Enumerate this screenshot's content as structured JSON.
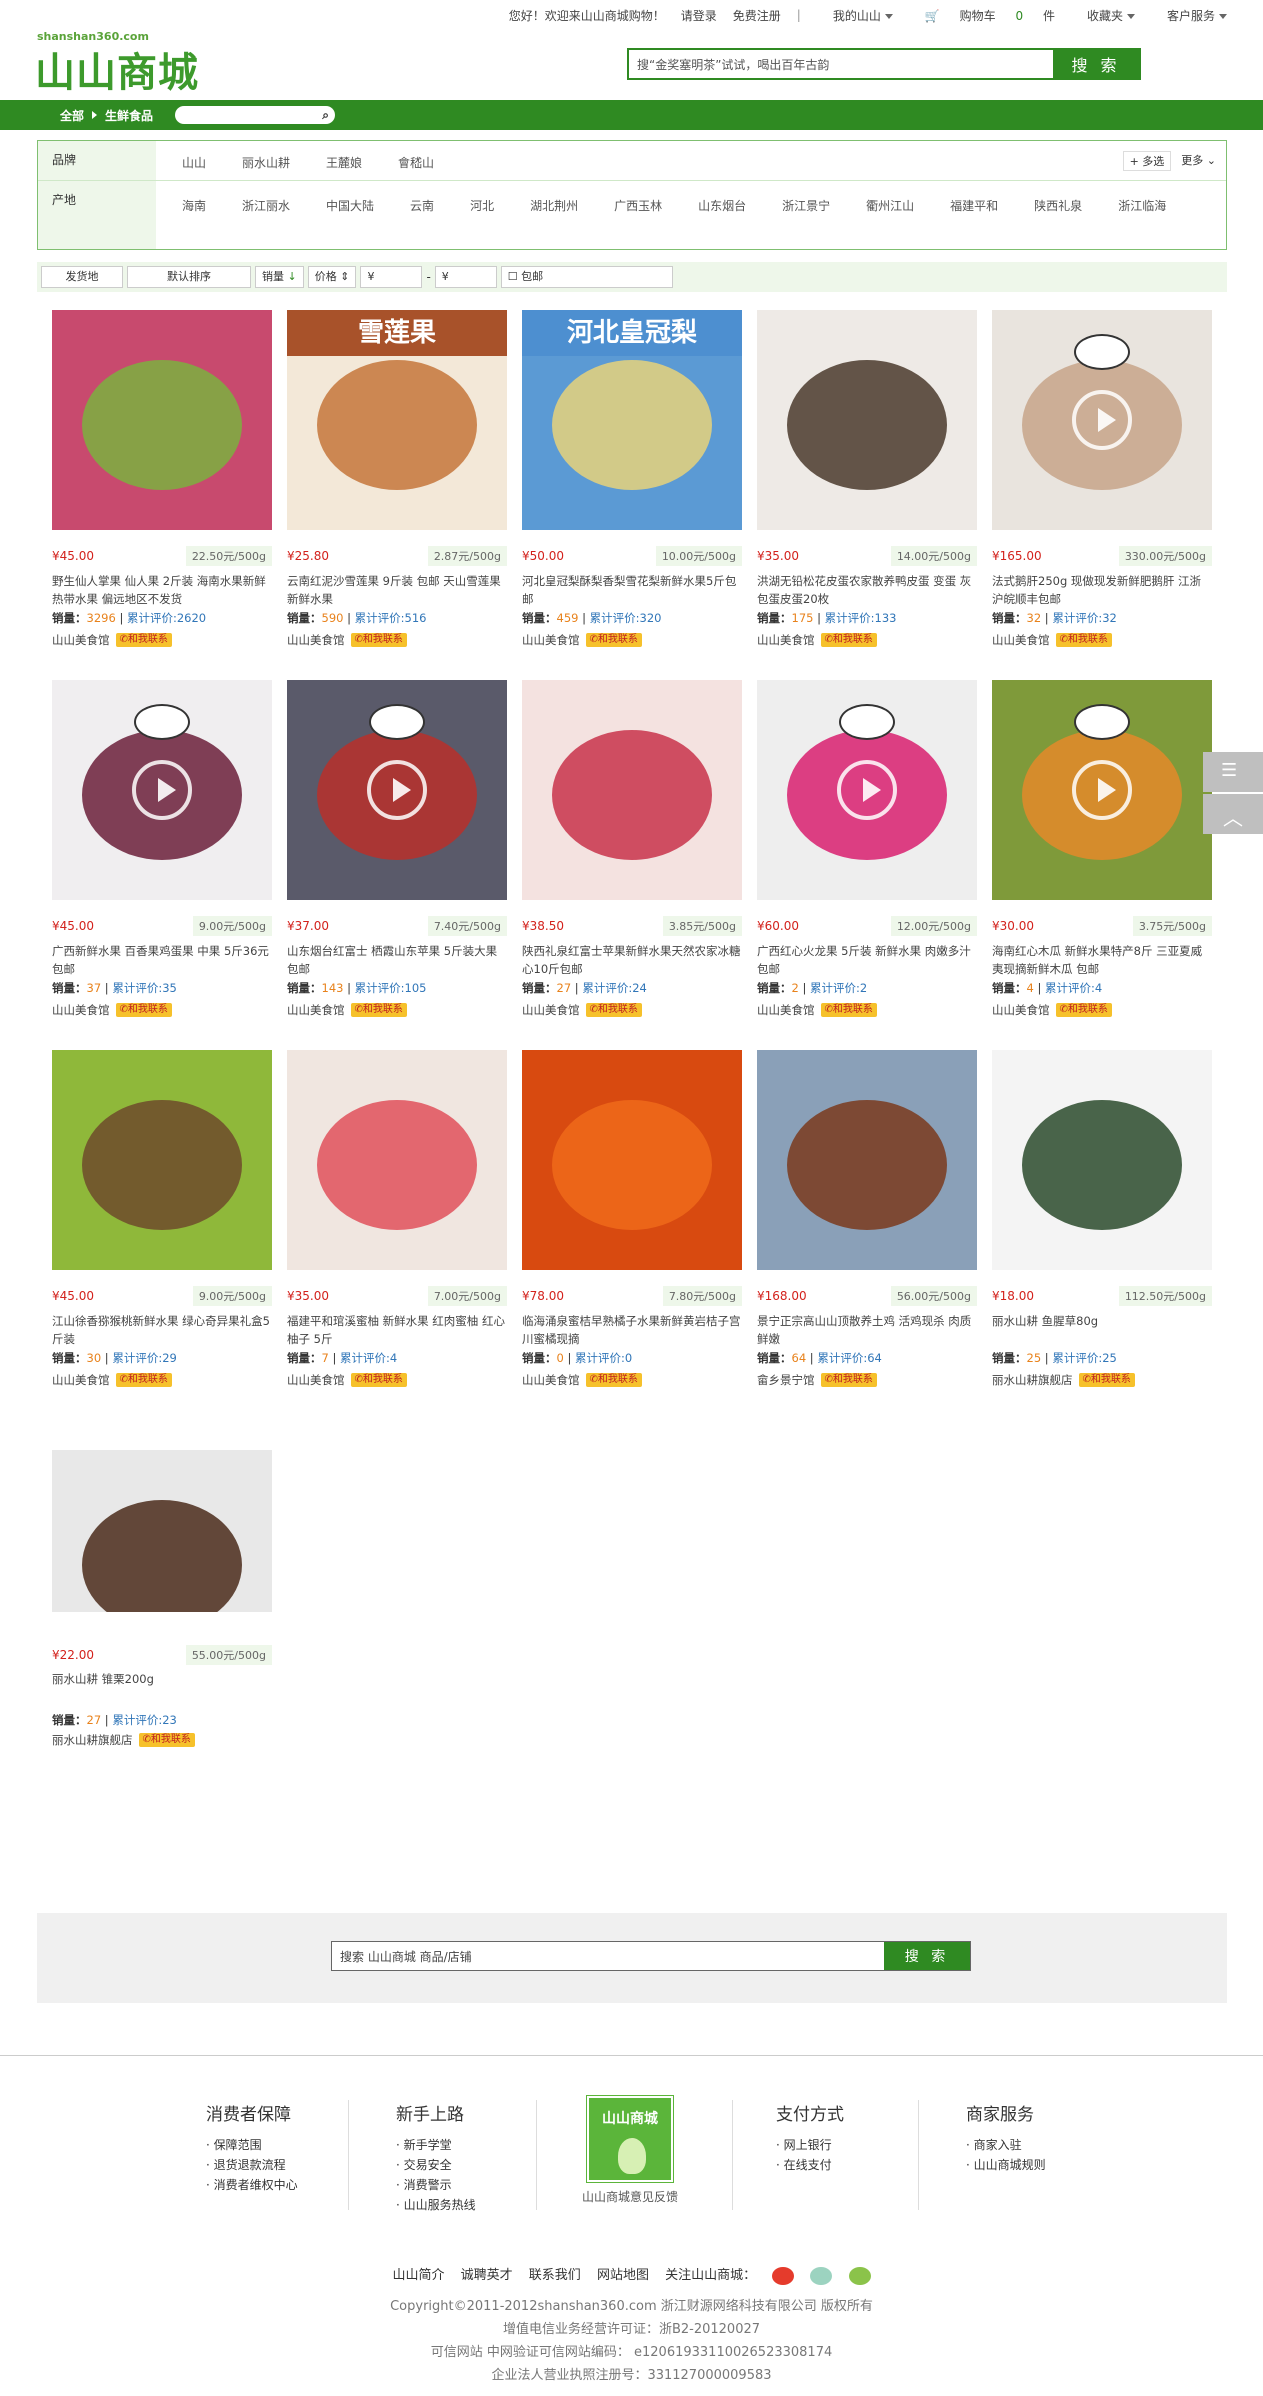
{
  "top": {
    "greeting": "您好！欢迎来山山商城购物！",
    "login": "请登录",
    "register": "免费注册",
    "sep": "|",
    "my_shop": "我的山山",
    "cart_label": "购物车",
    "cart_count": "0",
    "cart_unit": "件",
    "favorites": "收藏夹",
    "service": "客户服务"
  },
  "header": {
    "site_url": "shanshan360.com",
    "logo_text": "山山商城",
    "search_placeholder": "搜“金奖塞明茶”试试，喝出百年古韵",
    "search_button": "搜 索"
  },
  "nav": {
    "crumb_all": "全部",
    "crumb_category": "生鲜食品"
  },
  "filter": {
    "brand_label": "品牌",
    "brands": [
      "山山",
      "丽水山耕",
      "王麓娘",
      "會嵇山"
    ],
    "multi_select": "+ 多选",
    "more": "更多",
    "origin_label": "产地",
    "origins": [
      "海南",
      "浙江丽水",
      "中国大陆",
      "云南",
      "河北",
      "湖北荆州",
      "广西玉林",
      "山东烟台",
      "浙江景宁",
      "衢州江山",
      "福建平和",
      "陕西礼泉",
      "浙江临海"
    ]
  },
  "sort": {
    "ship_from": "发货地",
    "default_sort": "默认排序",
    "sales": "销量",
    "price": "价格",
    "price_min": "¥",
    "price_dash": "-",
    "price_max": "¥",
    "free_shipping": "包邮"
  },
  "products": [
    {
      "price": "¥45.00",
      "unit": "22.50元/500g",
      "title": "野生仙人掌果 仙人果 2斤装 海南水果新鲜热带水果 偏远地区不发货",
      "sales_label": "销量：",
      "sales": "3296",
      "sep": "|",
      "reviews": "累计评价:2620",
      "shop": "山山美食馆",
      "contact": "和我联系",
      "video": false,
      "color": "#7bb040",
      "color2": "#c84a6e"
    },
    {
      "price": "¥25.80",
      "unit": "2.87元/500g",
      "title": "云南红泥沙雪莲果 9斤装 包邮 天山雪莲果 新鲜水果",
      "sales_label": "销量：",
      "sales": "590",
      "sep": "|",
      "reviews": "累计评价:516",
      "shop": "山山美食馆",
      "contact": "和我联系",
      "video": false,
      "color": "#c4753b",
      "color2": "#f3e8d8",
      "banner": "雪莲果"
    },
    {
      "price": "¥50.00",
      "unit": "10.00元/500g",
      "title": "河北皇冠梨酥梨香梨雪花梨新鲜水果5斤包邮",
      "sales_label": "销量：",
      "sales": "459",
      "sep": "|",
      "reviews": "累计评价:320",
      "shop": "山山美食馆",
      "contact": "和我联系",
      "video": false,
      "color": "#e7d27a",
      "color2": "#5b9ad4",
      "banner": "河北皇冠梨"
    },
    {
      "price": "¥35.00",
      "unit": "14.00元/500g",
      "title": "洪湖无铅松花皮蛋农家散养鸭皮蛋 变蛋 灰包蛋皮蛋20枚",
      "sales_label": "销量：",
      "sales": "175",
      "sep": "|",
      "reviews": "累计评价:133",
      "shop": "山山美食馆",
      "contact": "和我联系",
      "video": false,
      "color": "#4a3a2c",
      "color2": "#eeeae6"
    },
    {
      "price": "¥165.00",
      "unit": "330.00元/500g",
      "title": "法式鹅肝250g 现做现发新鲜肥鹅肝 江浙沪皖顺丰包邮",
      "sales_label": "销量：",
      "sales": "32",
      "sep": "|",
      "reviews": "累计评价:32",
      "shop": "山山美食馆",
      "contact": "和我联系",
      "video": true,
      "color": "#c7a58a",
      "color2": "#e9e4de"
    },
    {
      "price": "¥45.00",
      "unit": "9.00元/500g",
      "title": "广西新鲜水果 百香果鸡蛋果 中果 5斤36元 包邮",
      "sales_label": "销量：",
      "sales": "37",
      "sep": "|",
      "reviews": "累计评价:35",
      "shop": "山山美食馆",
      "contact": "和我联系",
      "video": true,
      "color": "#6b1e3a",
      "color2": "#f0eef0"
    },
    {
      "price": "¥37.00",
      "unit": "7.40元/500g",
      "title": "山东烟台红富士 栖霞山东苹果 5斤装大果 包邮",
      "sales_label": "销量：",
      "sales": "143",
      "sep": "|",
      "reviews": "累计评价:105",
      "shop": "山山美食馆",
      "contact": "和我联系",
      "video": true,
      "color": "#b8302a",
      "color2": "#5a5a6a"
    },
    {
      "price": "¥38.50",
      "unit": "3.85元/500g",
      "title": "陕西礼泉红富士苹果新鲜水果天然农家冰糖心10斤包邮",
      "sales_label": "销量：",
      "sales": "27",
      "sep": "|",
      "reviews": "累计评价:24",
      "shop": "山山美食馆",
      "contact": "和我联系",
      "video": false,
      "color": "#c8324a",
      "color2": "#f4e2e0"
    },
    {
      "price": "¥60.00",
      "unit": "12.00元/500g",
      "title": "广西红心火龙果 5斤装 新鲜水果 肉嫩多汁 包邮",
      "sales_label": "销量：",
      "sales": "2",
      "sep": "|",
      "reviews": "累计评价:2",
      "shop": "山山美食馆",
      "contact": "和我联系",
      "video": true,
      "color": "#d81e6e",
      "color2": "#eeeeee"
    },
    {
      "price": "¥30.00",
      "unit": "3.75元/500g",
      "title": "海南红心木瓜 新鲜水果特产8斤 三亚夏威夷现摘新鲜木瓜 包邮",
      "sales_label": "销量：",
      "sales": "4",
      "sep": "|",
      "reviews": "累计评价:4",
      "shop": "山山美食馆",
      "contact": "和我联系",
      "video": true,
      "color": "#e48a2a",
      "color2": "#7f9a3a"
    },
    {
      "price": "¥45.00",
      "unit": "9.00元/500g",
      "title": "江山徐香猕猴桃新鲜水果 绿心奇异果礼盒5斤装",
      "sales_label": "销量：",
      "sales": "30",
      "sep": "|",
      "reviews": "累计评价:29",
      "shop": "山山美食馆",
      "contact": "和我联系",
      "video": false,
      "color": "#6e4a2c",
      "color2": "#8fb83a"
    },
    {
      "price": "¥35.00",
      "unit": "7.00元/500g",
      "title": "福建平和琯溪蜜柚 新鲜水果 红肉蜜柚 红心柚子 5斤",
      "sales_label": "销量：",
      "sales": "7",
      "sep": "|",
      "reviews": "累计评价:4",
      "shop": "山山美食馆",
      "contact": "和我联系",
      "video": false,
      "color": "#e0505a",
      "color2": "#f0e6e0"
    },
    {
      "price": "¥78.00",
      "unit": "7.80元/500g",
      "title": "临海涌泉蜜桔早熟橘子水果新鲜黄岩桔子宫川蜜橘现摘",
      "sales_label": "销量：",
      "sales": "0",
      "sep": "|",
      "reviews": "累计评价:0",
      "shop": "山山美食馆",
      "contact": "和我联系",
      "video": false,
      "color": "#f06a1a",
      "color2": "#d84a10"
    },
    {
      "price": "¥168.00",
      "unit": "56.00元/500g",
      "title": "景宁正宗高山山顶散养土鸡 活鸡现杀 肉质鲜嫩",
      "sales_label": "销量：",
      "sales": "64",
      "sep": "|",
      "reviews": "累计评价:64",
      "shop": "畲乡景宁馆",
      "contact": "和我联系",
      "video": false,
      "color": "#7a3a1c",
      "color2": "#8aa0b8"
    },
    {
      "price": "¥18.00",
      "unit": "112.50元/500g",
      "title": "丽水山耕 鱼腥草80g",
      "sales_label": "销量：",
      "sales": "25",
      "sep": "|",
      "reviews": "累计评价:25",
      "shop": "丽水山耕旗舰店",
      "contact": "和我联系",
      "video": false,
      "color": "#2a4a2c",
      "color2": "#f4f4f4"
    },
    {
      "price": "¥22.00",
      "unit": "55.00元/500g",
      "title": "丽水山耕 锥栗200g",
      "sales_label": "销量：",
      "sales": "27",
      "sep": "|",
      "reviews": "累计评价:23",
      "shop": "丽水山耕旗舰店",
      "contact": "和我联系",
      "video": false,
      "color": "#4a2a1a",
      "color2": "#e8e8e8"
    }
  ],
  "bottom_search": {
    "placeholder": "搜索 山山商城 商品/店铺",
    "button": "搜 索"
  },
  "footer": {
    "cols": [
      {
        "title": "消费者保障",
        "items": [
          "保障范围",
          "退货退款流程",
          "消费者维权中心"
        ]
      },
      {
        "title": "新手上路",
        "items": [
          "新手学堂",
          "交易安全",
          "消费警示",
          "山山服务热线"
        ]
      },
      {
        "title": "支付方式",
        "items": [
          "网上银行",
          "在线支付"
        ]
      },
      {
        "title": "商家服务",
        "items": [
          "商家入驻",
          "山山商城规则"
        ]
      }
    ],
    "feedback_logo": "山山商城",
    "feedback_label": "山山商城意见反馈",
    "links": [
      "山山简介",
      "诚聘英才",
      "联系我们",
      "网站地图",
      "关注山山商城："
    ],
    "copyright": "Copyright©2011-2012shanshan360.com 浙江财源网络科技有限公司 版权所有",
    "icp": "增值电信业务经营许可证：浙B2-20120027",
    "trust": "可信网站 中网验证可信网站编码： e12061933110026523308174",
    "license": "企业法人营业执照注册号：331127000009583"
  }
}
